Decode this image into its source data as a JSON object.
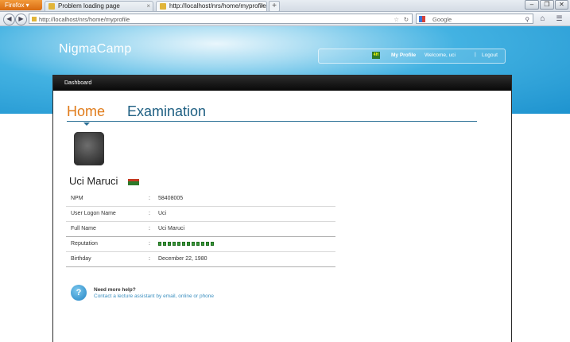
{
  "browser": {
    "menu_button": "Firefox",
    "tabs": [
      {
        "label": "Problem loading page"
      },
      {
        "label": "http://localhost/nrs/home/myprofile"
      }
    ],
    "new_tab": "+",
    "url": "http://localhost/nrs/home/myprofile",
    "search_placeholder": "Google"
  },
  "site": {
    "brand": "NigmaCamp",
    "user_badge": "4H",
    "my_profile": "My Profile",
    "welcome": "Welcome, uci",
    "separator": "|",
    "logout": "Logout"
  },
  "card": {
    "header": "Dashboard",
    "tabs": [
      "Home",
      "Examination"
    ]
  },
  "profile": {
    "name": "Uci Maruci",
    "rows": [
      {
        "label": "NPM",
        "value": "58408005"
      },
      {
        "label": "User Logon Name",
        "value": "Uci"
      },
      {
        "label": "Full Name",
        "value": "Uci Maruci"
      },
      {
        "label": "Reputation",
        "value": ""
      },
      {
        "label": "Birthday",
        "value": "December 22, 1980"
      }
    ],
    "reputation_level": 12
  },
  "help": {
    "title": "Need more help?",
    "text": "Contact a lecture assistant by email, online or phone"
  }
}
